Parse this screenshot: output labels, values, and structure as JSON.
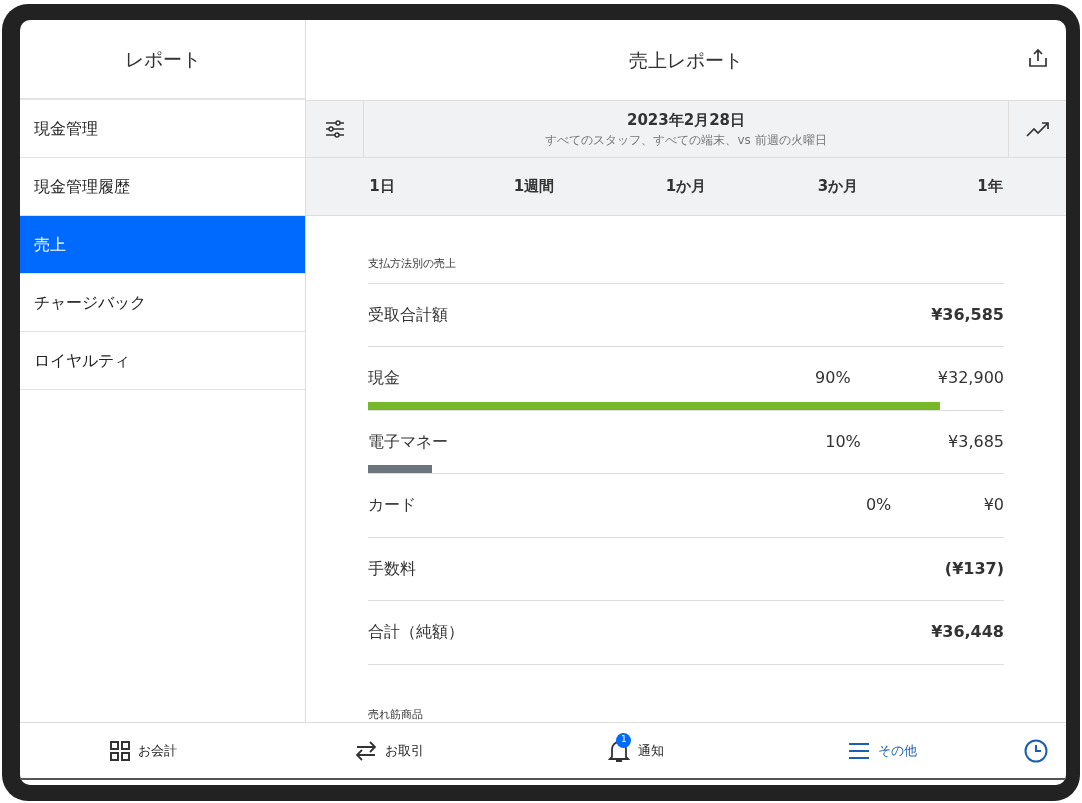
{
  "sidebar": {
    "title": "レポート",
    "items": [
      {
        "label": "現金管理",
        "selected": false
      },
      {
        "label": "現金管理履歴",
        "selected": false
      },
      {
        "label": "売上",
        "selected": true
      },
      {
        "label": "チャージバック",
        "selected": false
      },
      {
        "label": "ロイヤルティ",
        "selected": false
      }
    ]
  },
  "header": {
    "title": "売上レポート"
  },
  "filter": {
    "date": "2023年2月28日",
    "subtitle": "すべてのスタッフ、すべての端末、vs 前週の火曜日"
  },
  "periods": [
    {
      "label": "1日",
      "selected": false
    },
    {
      "label": "1週間",
      "selected": false
    },
    {
      "label": "1か月",
      "selected": false
    },
    {
      "label": "3か月",
      "selected": false
    },
    {
      "label": "1年",
      "selected": false
    }
  ],
  "section": {
    "title": "支払方法別の売上",
    "rows": [
      {
        "kind": "total",
        "label": "受取合計額",
        "amount": "¥36,585"
      },
      {
        "kind": "method",
        "label": "現金",
        "percent": "90%",
        "amount": "¥32,900",
        "level": 0.9,
        "color": "#77b82a"
      },
      {
        "kind": "method",
        "label": "電子マネー",
        "percent": "10%",
        "amount": "¥3,685",
        "level": 0.1,
        "color": "#6c757d"
      },
      {
        "kind": "method",
        "label": "カード",
        "percent": "0%",
        "amount": "¥0"
      },
      {
        "kind": "total",
        "label": "手数料",
        "amount": "(¥137)"
      },
      {
        "kind": "total",
        "label": "合計（純額）",
        "amount": "¥36,448"
      }
    ]
  },
  "next_section": {
    "title": "売れ筋商品"
  },
  "bottom_nav": [
    {
      "kind": "grid",
      "label": "お会計",
      "selected": false
    },
    {
      "kind": "arrows",
      "label": "お取引",
      "selected": false
    },
    {
      "kind": "bell",
      "label": "通知",
      "badge": "1",
      "selected": false
    },
    {
      "kind": "menu",
      "label": "その他",
      "selected": true
    }
  ]
}
